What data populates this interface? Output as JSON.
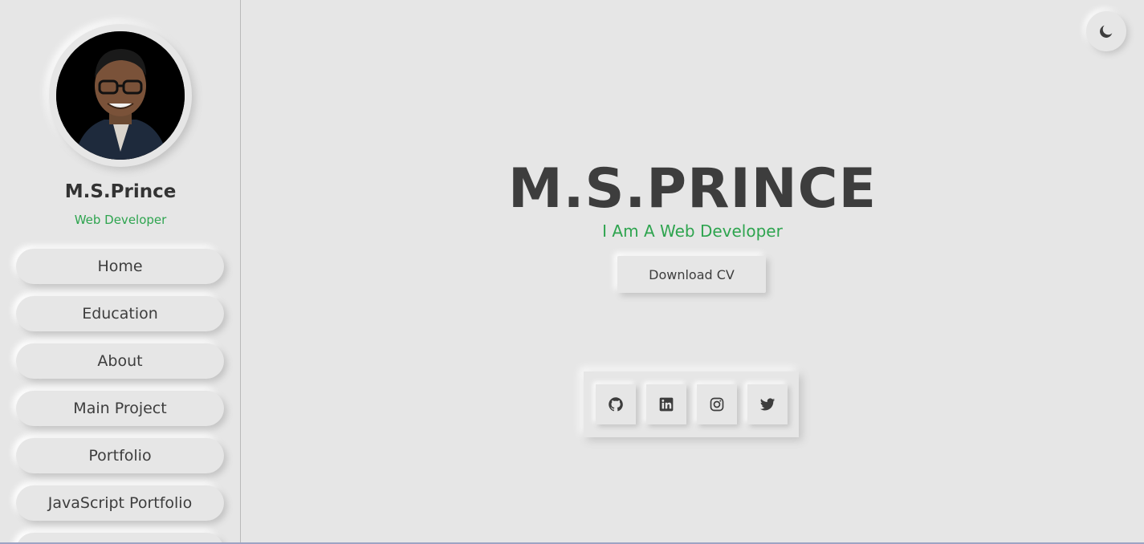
{
  "sidebar": {
    "name": "M.S.Prince",
    "role": "Web Developer",
    "nav": [
      {
        "label": "Home"
      },
      {
        "label": "Education"
      },
      {
        "label": "About"
      },
      {
        "label": "Main Project"
      },
      {
        "label": "Portfolio"
      },
      {
        "label": "JavaScript Portfolio"
      },
      {
        "label": ""
      }
    ]
  },
  "hero": {
    "title": "M.S.PRINCE",
    "subtitle": "I Am A Web Developer",
    "cv_label": "Download CV"
  },
  "theme_toggle": {
    "icon": "moon-icon"
  },
  "social": [
    {
      "icon": "github-icon"
    },
    {
      "icon": "linkedin-icon"
    },
    {
      "icon": "instagram-icon"
    },
    {
      "icon": "twitter-icon"
    }
  ],
  "colors": {
    "background": "#e6e6e6",
    "accent": "#2ea44f",
    "text": "#3d3d3d"
  }
}
